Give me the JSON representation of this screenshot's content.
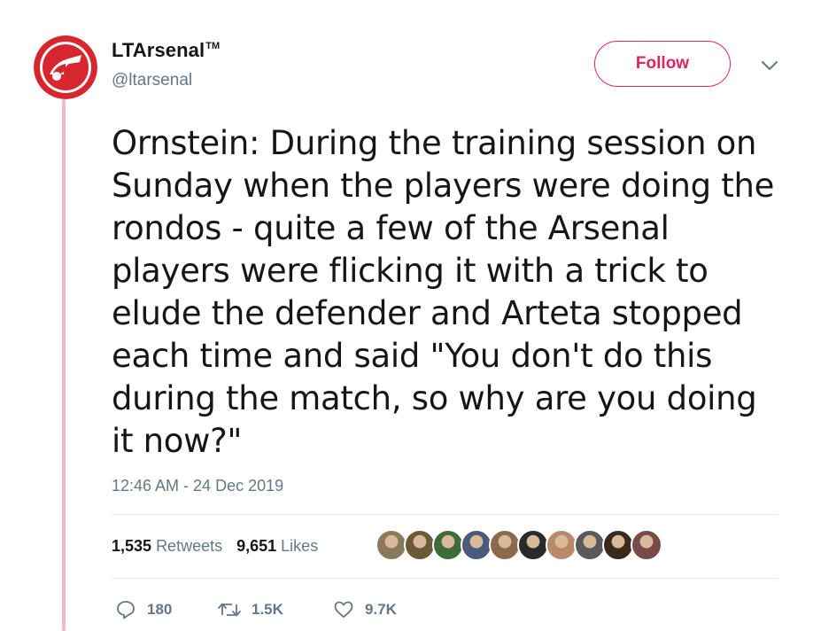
{
  "author": {
    "display_name": "LTArsenal",
    "trademark": "TM",
    "handle": "@ltarsenal",
    "avatar_icon": "ltarsenal-logo"
  },
  "follow_label": "Follow",
  "tweet": {
    "text": "Ornstein: During the training session on Sunday when the players were doing the rondos - quite a few of the Arsenal players were flicking it with a trick to elude the defender and Arteta stopped each time and said \"You don't do this during the match, so why are you doing it now?\"",
    "timestamp": "12:46 AM - 24 Dec 2019"
  },
  "stats": {
    "retweets_count": "1,535",
    "retweets_label": "Retweets",
    "likes_count": "9,651",
    "likes_label": "Likes"
  },
  "liker_colors": [
    "#8a7a5c",
    "#6b5a3a",
    "#3d6b3a",
    "#4a5a7a",
    "#8a6a4a",
    "#2a2a2a",
    "#b88a6a",
    "#5a5a5a",
    "#3a2a1e",
    "#7a4a4a"
  ],
  "actions": {
    "reply_count": "180",
    "retweet_count": "1.5K",
    "like_count": "9.7K"
  },
  "colors": {
    "brand_red": "#e0245e",
    "thread_line": "#f4b8c8",
    "muted": "#657786"
  }
}
